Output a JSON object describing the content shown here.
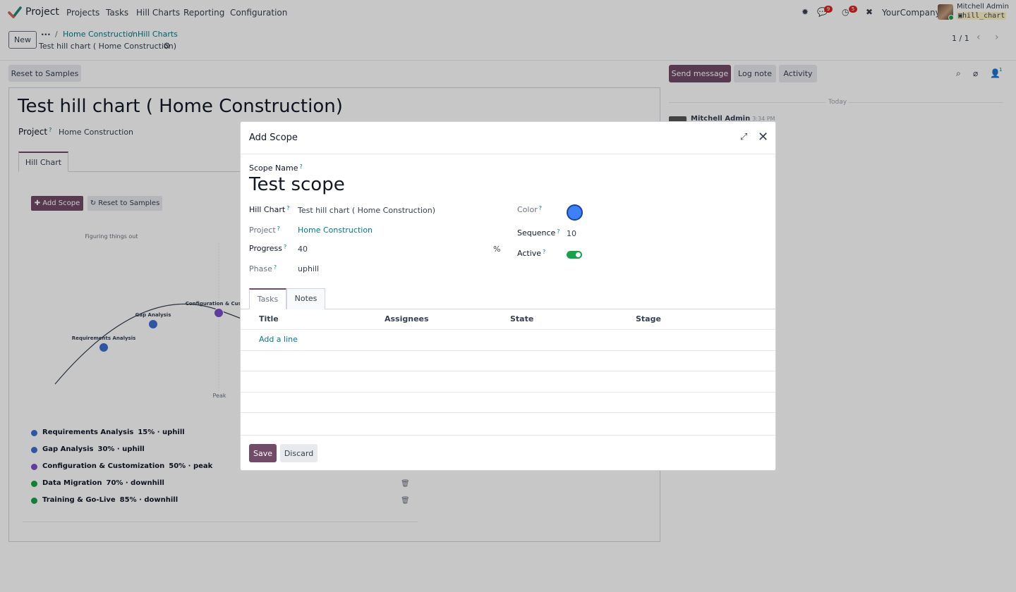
{
  "navbar": {
    "app_name": "Project",
    "menu": [
      "Projects",
      "Tasks",
      "Hill Charts",
      "Reporting",
      "Configuration"
    ],
    "messages_badge": "9",
    "activities_badge": "5",
    "company": "YourCompany",
    "user_name": "Mitchell Admin",
    "db_name": "hill_chart"
  },
  "control_panel": {
    "new_label": "New",
    "breadcrumb": [
      "Home Construction",
      "Hill Charts"
    ],
    "current_record": "Test hill chart ( Home Construction)",
    "pager": "1 / 1"
  },
  "actions": {
    "reset_label": "Reset to Samples"
  },
  "form": {
    "title": "Test hill chart ( Home Construction)",
    "project_label": "Project",
    "project_value": "Home Construction",
    "tab_label": "Hill Chart",
    "add_scope_label": "Add Scope",
    "reset_samples_label": "Reset to Samples"
  },
  "hill_chart": {
    "labels": {
      "uphill": "Figuring things out",
      "peak": "Peak"
    },
    "points": [
      {
        "name": "Requirements Analysis",
        "progress": 15,
        "color": "#3b6fd4"
      },
      {
        "name": "Gap Analysis",
        "progress": 30,
        "color": "#3b6fd4"
      },
      {
        "name": "Configuration & Custom",
        "progress": 50,
        "color": "#7c4dcc"
      }
    ]
  },
  "legend": [
    {
      "name": "Requirements Analysis",
      "meta": "15% · uphill",
      "color": "#3b6fd4",
      "trash": false
    },
    {
      "name": "Gap Analysis",
      "meta": "30% · uphill",
      "color": "#3b6fd4",
      "trash": false
    },
    {
      "name": "Configuration & Customization",
      "meta": "50% · peak",
      "color": "#7c4dcc",
      "trash": false
    },
    {
      "name": "Data Migration",
      "meta": "70% · downhill",
      "color": "#16a34a",
      "trash": true
    },
    {
      "name": "Training & Go-Live",
      "meta": "85% · downhill",
      "color": "#16a34a",
      "trash": true
    }
  ],
  "chatter": {
    "send_message": "Send message",
    "log_note": "Log note",
    "activity": "Activity",
    "followers_count": "1",
    "date_separator": "Today",
    "message_author": "Mitchell Admin",
    "message_time": "3:34 PM"
  },
  "modal": {
    "title": "Add Scope",
    "scope_name_label": "Scope Name",
    "scope_name_value": "Test scope",
    "hill_chart_label": "Hill Chart",
    "hill_chart_value": "Test hill chart ( Home Construction)",
    "project_label": "Project",
    "project_value": "Home Construction",
    "progress_label": "Progress",
    "progress_value": "40",
    "progress_unit": "%",
    "phase_label": "Phase",
    "phase_value": "uphill",
    "color_label": "Color",
    "color_value": "#3b82f6",
    "sequence_label": "Sequence",
    "sequence_value": "10",
    "active_label": "Active",
    "active_value": true,
    "tabs": [
      "Tasks",
      "Notes"
    ],
    "columns": [
      "Title",
      "Assignees",
      "State",
      "Stage"
    ],
    "add_line": "Add a line",
    "save": "Save",
    "discard": "Discard"
  }
}
